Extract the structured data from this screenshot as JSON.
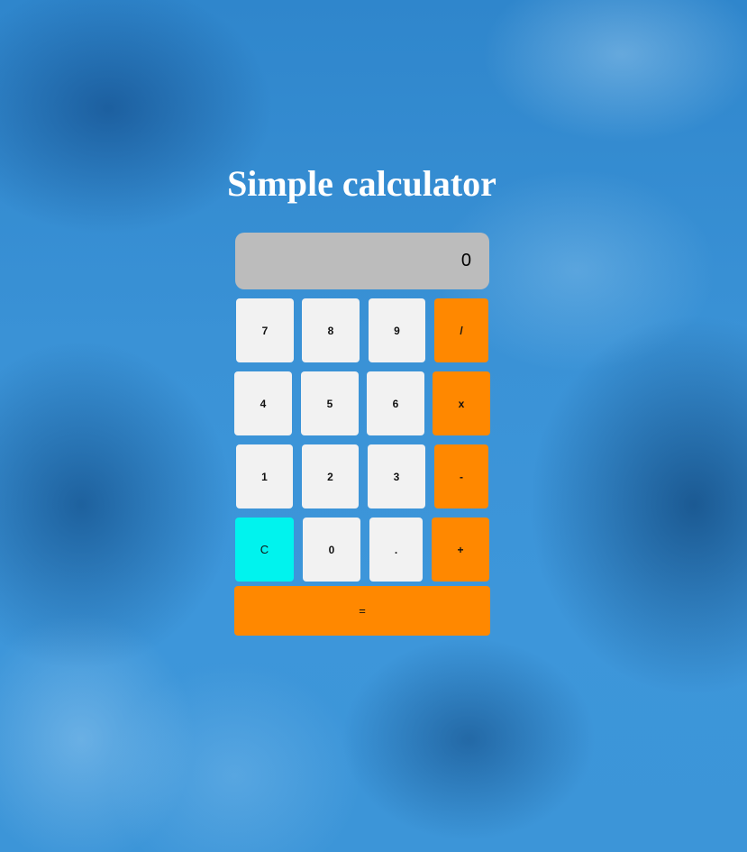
{
  "page": {
    "title": "Simple calculator"
  },
  "calculator": {
    "display_value": "0",
    "keys": {
      "seven": "7",
      "eight": "8",
      "nine": "9",
      "divide": "/",
      "four": "4",
      "five": "5",
      "six": "6",
      "multiply": "x",
      "one": "1",
      "two": "2",
      "three": "3",
      "subtract": "-",
      "clear": "C",
      "zero": "0",
      "decimal": ".",
      "add": "+",
      "equals": "="
    },
    "colors": {
      "number_key": "#f2f2f2",
      "operator_key": "#ff8800",
      "clear_key": "#00f3ee",
      "display_background": "#bcbcbc",
      "title_text": "#ffffff"
    }
  }
}
